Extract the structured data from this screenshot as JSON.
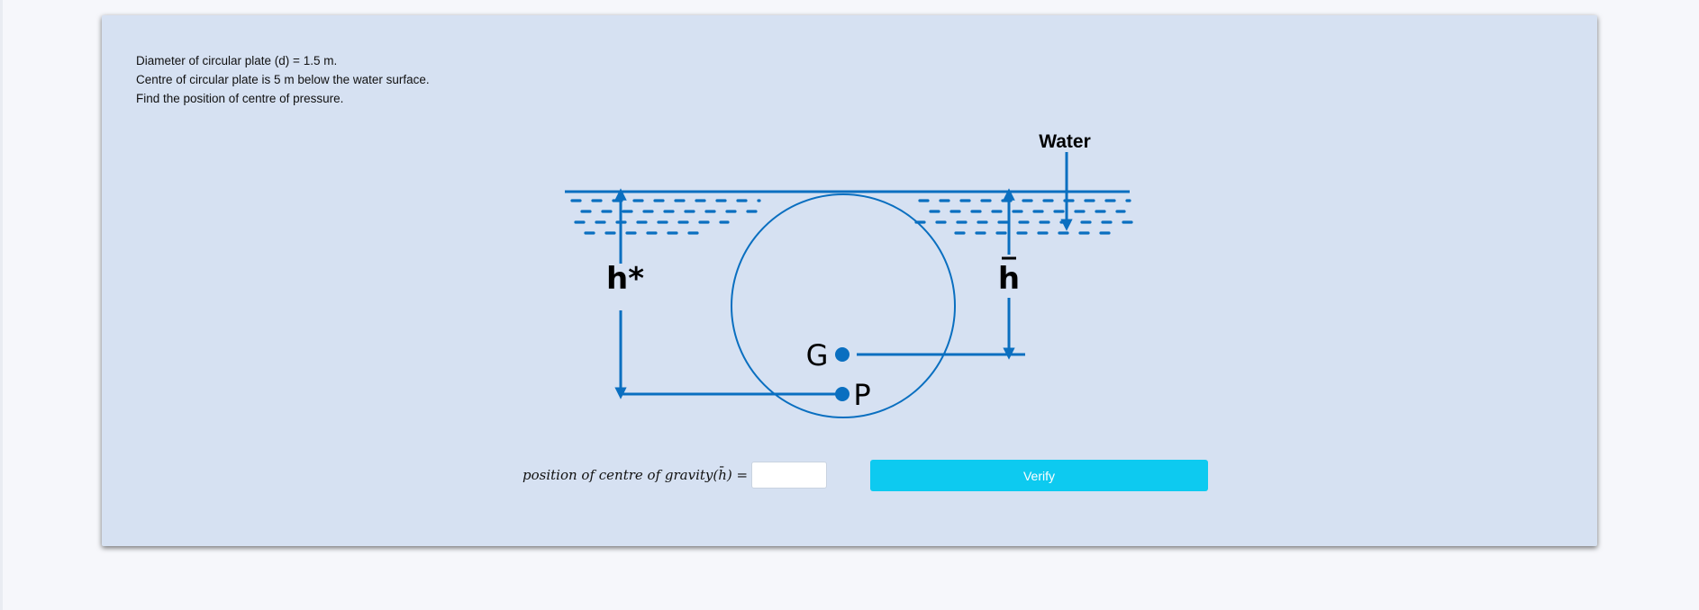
{
  "problem": {
    "line1": "Diameter of circular plate (d) = 1.5 m.",
    "line2": "Centre of circular plate is 5 m below the water surface.",
    "line3": "Find the position of centre of pressure."
  },
  "diagram": {
    "water_label": "Water",
    "h_star_label": "h*",
    "h_bar_label": "h",
    "g_label": "G",
    "p_label": "P",
    "stroke_color": "#0a6fc0"
  },
  "answer": {
    "label": "position of centre of gravity(h̄) =",
    "value": "",
    "placeholder": ""
  },
  "verify": {
    "label": "Verify",
    "color": "#0dcaf0"
  }
}
